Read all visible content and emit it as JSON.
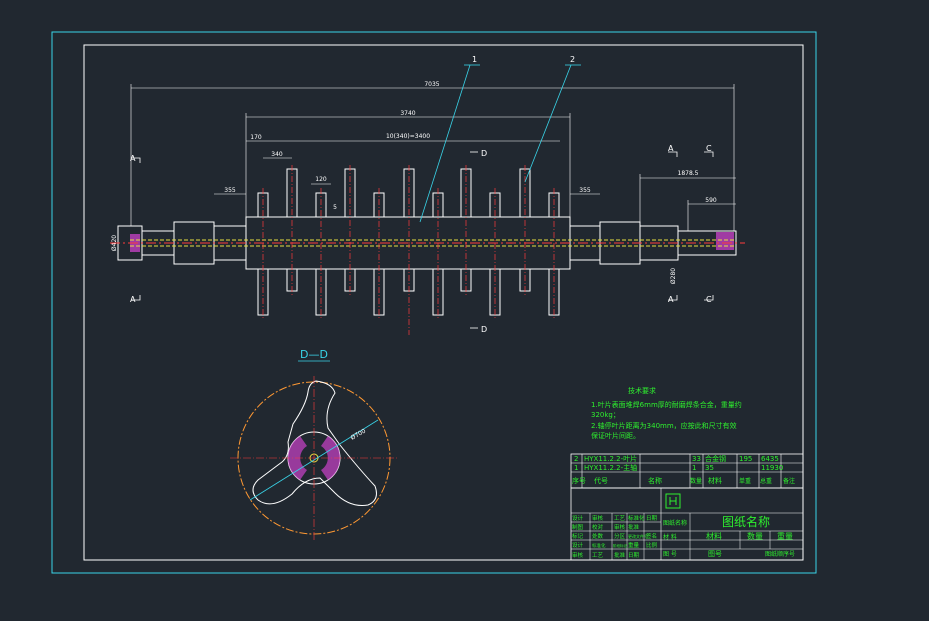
{
  "drawing": {
    "dims": {
      "overall": "7035",
      "body": "3740",
      "pitch": "10(340)=3400",
      "left_offset": "170",
      "spacing": "340",
      "blade_w": "120",
      "blade_t": "5",
      "left_shaft": "355",
      "right_shaft": "355",
      "right_len": "1878.5",
      "right_small": "590",
      "left_dia": "Ø420",
      "right_dia": "Ø280"
    },
    "callouts": {
      "part1": "1",
      "part2": "2"
    },
    "section_marks": {
      "a": "A",
      "c": "C",
      "d": "D"
    },
    "section_title": "D—D",
    "section_dia": "Ø700",
    "tech": {
      "title": "技术要求",
      "line1": "1.叶片表面堆焊6mm厚的耐磨焊条合金，重量约",
      "line1b": "320kg；",
      "line2": "2.轴停叶片距离为340mm，应按此和尺寸有效",
      "line2b": "保证叶片间距。"
    },
    "bom": {
      "row2": [
        "2",
        "HYX11.2.2-叶片",
        "33",
        "合金钢",
        "195",
        "6435"
      ],
      "row1": [
        "1",
        "HYX11.2.2-主轴",
        "1",
        "35",
        "",
        "11930"
      ],
      "header": [
        "序号",
        "代号",
        "名称",
        "数量",
        "材料",
        "单重",
        "总重",
        "备注"
      ]
    },
    "title_block": {
      "title": "图纸名称",
      "drawing_name": "图纸名称",
      "material": "材料",
      "quantity": "数量",
      "weight": "重量",
      "material2": "材 料",
      "drawing_no": "图 号",
      "sheet_no": "图号",
      "sheet_order": "图纸顺序号",
      "rows": [
        [
          "设计",
          "审核",
          "工艺",
          "标准化",
          "日期"
        ],
        [
          "制图",
          "校对",
          "审核",
          "批准",
          ""
        ],
        [
          "标记",
          "处数",
          "分区",
          "更改文件号",
          "签名"
        ],
        [
          "设计",
          "标准化",
          "阶段标记",
          "重量",
          "比例"
        ],
        [
          "审核",
          "工艺",
          "批准",
          "日期",
          ""
        ]
      ]
    },
    "colors": {
      "background": "#212830",
      "frame": "#39d4e8",
      "outline": "#ffffff",
      "centerline": "#ff3b3b",
      "dimension": "#ffffff",
      "text": "#2ef02e",
      "section": "#ff9933",
      "hatch": "#c040c0",
      "bore": "#e8e040"
    }
  }
}
